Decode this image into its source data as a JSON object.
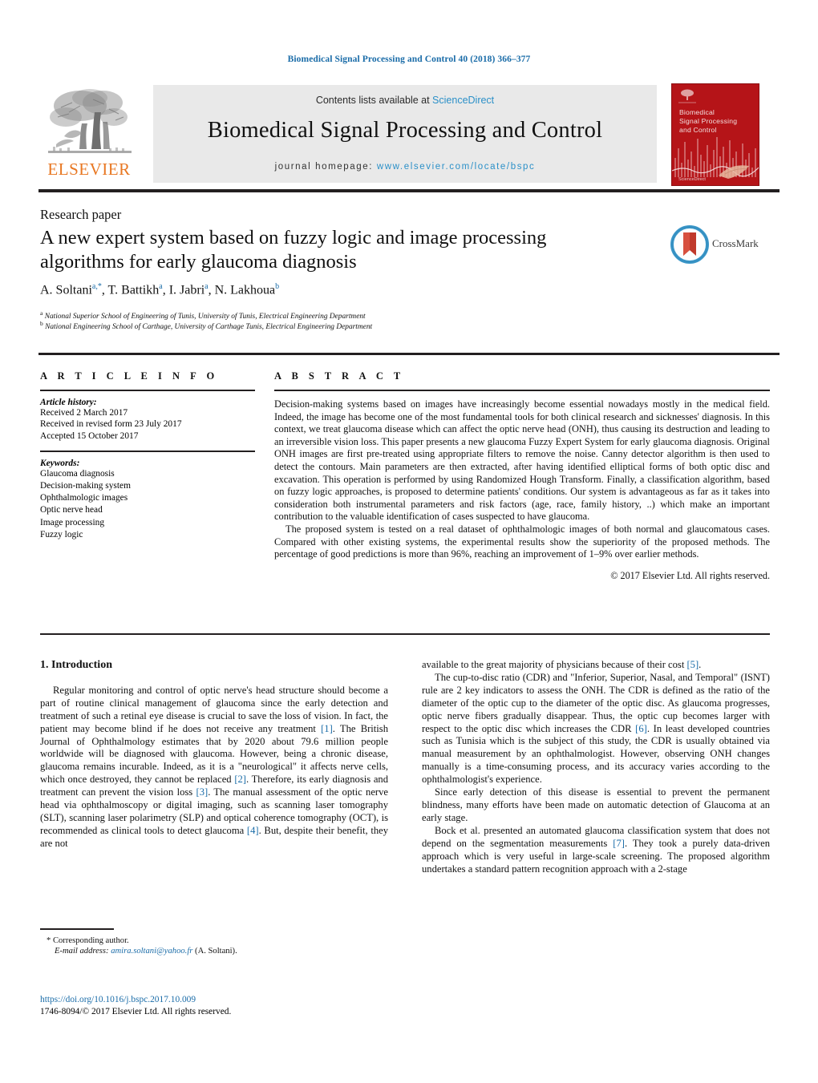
{
  "running_head": "Biomedical Signal Processing and Control 40 (2018) 366–377",
  "masthead": {
    "publisher_name": "ELSEVIER",
    "contents_prefix": "Contents lists available at ",
    "contents_link": "ScienceDirect",
    "journal_name": "Biomedical Signal Processing and Control",
    "homepage_prefix": "journal homepage: ",
    "homepage_url": "www.elsevier.com/locate/bspc",
    "cover": {
      "title_line1": "Biomedical",
      "title_line2": "Signal Processing",
      "title_line3": "and Control",
      "footer": "ScienceDirect"
    },
    "colors": {
      "link_blue": "#2b90c8",
      "elsevier_orange": "#e87722",
      "cover_red": "#b51418",
      "panel_grey": "#e9e9e9"
    }
  },
  "article": {
    "type": "Research paper",
    "title": "A new expert system based on fuzzy logic and image processing algorithms for early glaucoma diagnosis",
    "authors_html": "A. Soltani<sup>a,*</sup>, T. Battikh<sup>a</sup>, I. Jabri<sup>a</sup>, N. Lakhoua<sup>b</sup>",
    "affiliations": [
      "National Superior School of Engineering of Tunis, University of Tunis, Electrical Engineering Department",
      "National Engineering School of Carthage, University of Carthage Tunis, Electrical Engineering Department"
    ],
    "crossmark_label": "CrossMark"
  },
  "info": {
    "heading": "A R T I C L E    I N F O",
    "history_label": "Article history:",
    "history": [
      "Received 2 March 2017",
      "Received in revised form 23 July 2017",
      "Accepted 15 October 2017"
    ],
    "keywords_label": "Keywords:",
    "keywords": [
      "Glaucoma diagnosis",
      "Decision-making system",
      "Ophthalmologic images",
      "Optic nerve head",
      "Image processing",
      "Fuzzy logic"
    ]
  },
  "abstract": {
    "heading": "A B S T R A C T",
    "paragraph1": "Decision-making systems based on images have increasingly become essential nowadays mostly in the medical field. Indeed, the image has become one of the most fundamental tools for both clinical research and sicknesses' diagnosis. In this context, we treat glaucoma disease which can affect the optic nerve head (ONH), thus causing its destruction and leading to an irreversible vision loss. This paper presents a new glaucoma Fuzzy Expert System for early glaucoma diagnosis. Original ONH images are first pre-treated using appropriate filters to remove the noise. Canny detector algorithm is then used to detect the contours. Main parameters are then extracted, after having identified elliptical forms of both optic disc and excavation. This operation is performed by using Randomized Hough Transform. Finally, a classification algorithm, based on fuzzy logic approaches, is proposed to determine patients' conditions. Our system is advantageous as far as it takes into consideration both instrumental parameters and risk factors (age, race, family history, ..) which make an important contribution to the valuable identification of cases suspected to have glaucoma.",
    "paragraph2": "The proposed system is tested on a real dataset of ophthalmologic images of both normal and glaucomatous cases. Compared with other existing systems, the experimental results show the superiority of the proposed methods. The percentage of good predictions is more than 96%, reaching an improvement of 1–9% over earlier methods.",
    "copyright": "© 2017 Elsevier Ltd. All rights reserved."
  },
  "introduction": {
    "heading": "1.  Introduction",
    "left_paragraph_1a": "Regular monitoring and control of optic nerve's head structure should become a part of routine clinical management of glaucoma since the early detection and treatment of such a retinal eye disease is crucial to save the loss of vision. In fact, the patient may become blind if he does not receive any treatment ",
    "cite1": "[1]",
    "left_paragraph_1b": ". The British Journal of Ophthalmology estimates that by 2020 about 79.6 million people worldwide will be diagnosed with glaucoma. However, being a chronic disease, glaucoma remains incurable. Indeed, as it is a \"neurological\" it affects nerve cells, which once destroyed, they cannot be replaced ",
    "cite2": "[2]",
    "left_paragraph_1c": ". Therefore, its early diagnosis and treatment can prevent the vision loss ",
    "cite3": "[3]",
    "left_paragraph_1d": ". The manual assessment of the optic nerve head via ophthalmoscopy or digital imaging, such as scanning laser tomography (SLT), scanning laser polarimetry (SLP) and optical coherence tomography (OCT), is recommended as clinical tools to detect glaucoma ",
    "cite4": "[4]",
    "left_paragraph_1e": ". But, despite their benefit, they are not",
    "right_paragraph_0a": "available to the great majority of physicians because of their cost ",
    "cite5": "[5]",
    "right_paragraph_0b": ".",
    "right_paragraph_1a": "The cup-to-disc ratio (CDR) and \"Inferior, Superior, Nasal, and Temporal\" (ISNT) rule are 2 key indicators to assess the ONH. The CDR is defined as the ratio of the diameter of the optic cup to the diameter of the optic disc. As glaucoma progresses, optic nerve fibers gradually disappear. Thus, the optic cup becomes larger with respect to the optic disc which increases the CDR ",
    "cite6": "[6]",
    "right_paragraph_1b": ". In least developed countries such as Tunisia which is the subject of this study, the CDR is usually obtained via manual measurement by an ophthalmologist. However, observing ONH changes manually is a time-consuming process, and its accuracy varies according to the ophthalmologist's experience.",
    "right_paragraph_2": "Since early detection of this disease is essential to prevent the permanent blindness, many efforts have been made on automatic detection of Glaucoma at an early stage.",
    "right_paragraph_3a": "Bock et al. presented an automated glaucoma classification system that does not depend on the segmentation measurements ",
    "cite7": "[7]",
    "right_paragraph_3b": ". They took a purely data-driven approach which is very useful in large-scale screening. The proposed algorithm undertakes a standard pattern recognition approach with a 2-stage"
  },
  "footnotes": {
    "corresponding_author": "*  Corresponding author.",
    "email_label": "E-mail address:",
    "email": "amira.soltani@yahoo.fr",
    "email_who": "(A. Soltani).",
    "doi": "https://doi.org/10.1016/j.bspc.2017.10.009",
    "issn_line": "1746-8094/© 2017 Elsevier Ltd. All rights reserved."
  }
}
